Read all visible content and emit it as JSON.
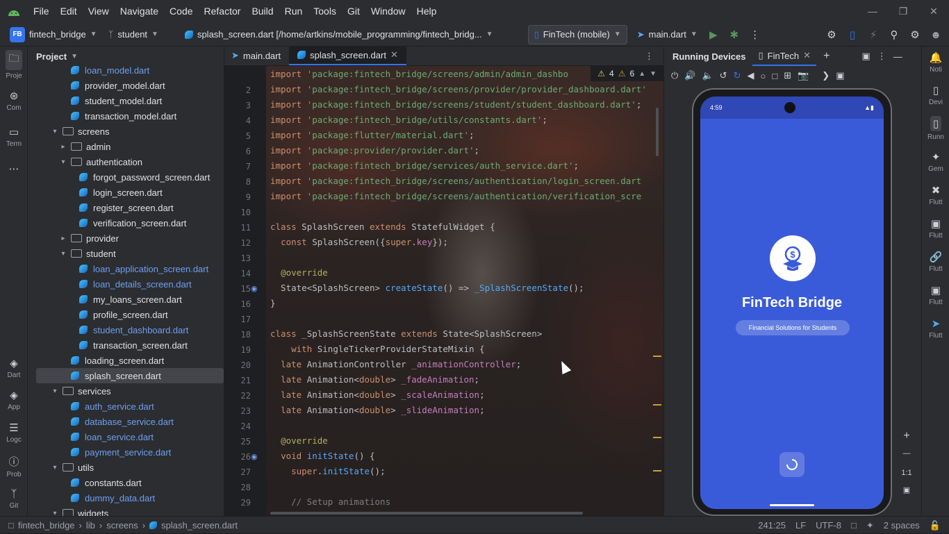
{
  "menu": [
    "File",
    "Edit",
    "View",
    "Navigate",
    "Code",
    "Refactor",
    "Build",
    "Run",
    "Tools",
    "Git",
    "Window",
    "Help"
  ],
  "toolbar": {
    "project_badge": "FB",
    "project_name": "fintech_bridge",
    "branch": "student",
    "file_path": "splash_screen.dart [/home/artkins/mobile_programming/fintech_bridg...",
    "device": "FinTech (mobile)",
    "run_config": "main.dart"
  },
  "left_strip": [
    {
      "icon": "folder-icon",
      "label": "Proje"
    },
    {
      "icon": "commit-icon",
      "label": "Com"
    },
    {
      "icon": "terminal-icon",
      "label": "Term"
    },
    {
      "icon": "more-icon",
      "label": "..."
    },
    {
      "icon": "dart-icon",
      "label": "Dart"
    },
    {
      "icon": "app-inspection-icon",
      "label": "App"
    },
    {
      "icon": "logcat-icon",
      "label": "Logc"
    },
    {
      "icon": "problems-icon",
      "label": "Prob"
    },
    {
      "icon": "git-icon",
      "label": "Git"
    }
  ],
  "project_panel": {
    "title": "Project",
    "tree": [
      {
        "label": "loan_model.dart",
        "type": "dart",
        "depth": 3,
        "blue": true
      },
      {
        "label": "provider_model.dart",
        "type": "dart",
        "depth": 3
      },
      {
        "label": "student_model.dart",
        "type": "dart",
        "depth": 3
      },
      {
        "label": "transaction_model.dart",
        "type": "dart",
        "depth": 3
      },
      {
        "label": "screens",
        "type": "folder",
        "depth": 2,
        "open": true
      },
      {
        "label": "admin",
        "type": "folder",
        "depth": 3,
        "open": false
      },
      {
        "label": "authentication",
        "type": "folder",
        "depth": 3,
        "open": true
      },
      {
        "label": "forgot_password_screen.dart",
        "type": "dart",
        "depth": 4
      },
      {
        "label": "login_screen.dart",
        "type": "dart",
        "depth": 4
      },
      {
        "label": "register_screen.dart",
        "type": "dart",
        "depth": 4
      },
      {
        "label": "verification_screen.dart",
        "type": "dart",
        "depth": 4
      },
      {
        "label": "provider",
        "type": "folder",
        "depth": 3,
        "open": false
      },
      {
        "label": "student",
        "type": "folder",
        "depth": 3,
        "open": true
      },
      {
        "label": "loan_application_screen.dart",
        "type": "dart",
        "depth": 4,
        "blue": true
      },
      {
        "label": "loan_details_screen.dart",
        "type": "dart",
        "depth": 4,
        "blue": true
      },
      {
        "label": "my_loans_screen.dart",
        "type": "dart",
        "depth": 4
      },
      {
        "label": "profile_screen.dart",
        "type": "dart",
        "depth": 4
      },
      {
        "label": "student_dashboard.dart",
        "type": "dart",
        "depth": 4,
        "blue": true
      },
      {
        "label": "transaction_screen.dart",
        "type": "dart",
        "depth": 4
      },
      {
        "label": "loading_screen.dart",
        "type": "dart",
        "depth": 3
      },
      {
        "label": "splash_screen.dart",
        "type": "dart",
        "depth": 3,
        "selected": true
      },
      {
        "label": "services",
        "type": "folder",
        "depth": 2,
        "open": true
      },
      {
        "label": "auth_service.dart",
        "type": "dart",
        "depth": 3,
        "blue": true
      },
      {
        "label": "database_service.dart",
        "type": "dart",
        "depth": 3,
        "blue": true
      },
      {
        "label": "loan_service.dart",
        "type": "dart",
        "depth": 3,
        "blue": true
      },
      {
        "label": "payment_service.dart",
        "type": "dart",
        "depth": 3,
        "blue": true
      },
      {
        "label": "utils",
        "type": "folder",
        "depth": 2,
        "open": true
      },
      {
        "label": "constants.dart",
        "type": "dart",
        "depth": 3
      },
      {
        "label": "dummy_data.dart",
        "type": "dart",
        "depth": 3,
        "blue": true
      },
      {
        "label": "widgets",
        "type": "folder",
        "depth": 2,
        "open": true
      }
    ]
  },
  "editor": {
    "tabs": [
      {
        "label": "main.dart",
        "active": false
      },
      {
        "label": "splash_screen.dart",
        "active": true
      }
    ],
    "warnings": "4",
    "weak_warnings": "6",
    "lines": [
      {
        "n": "",
        "html": "<span class='k'>import</span> <span class='s'>'package:fintech_bridge/screens/admin/admin_dashbo</span>"
      },
      {
        "n": "2",
        "html": "<span class='k'>import</span> <span class='s'>'package:fintech_bridge/screens/provider/provider_dashboard.dart'</span>"
      },
      {
        "n": "3",
        "html": "<span class='k'>import</span> <span class='s'>'package:fintech_bridge/screens/student/student_dashboard.dart'</span>;"
      },
      {
        "n": "4",
        "html": "<span class='k'>import</span> <span class='s'>'package:fintech_bridge/utils/constants.dart'</span>;"
      },
      {
        "n": "5",
        "html": "<span class='k'>import</span> <span class='s'>'package:flutter/material.dart'</span>;"
      },
      {
        "n": "6",
        "html": "<span class='k'>import</span> <span class='s'>'package:provider/provider.dart'</span>;"
      },
      {
        "n": "7",
        "html": "<span class='k'>import</span> <span class='s'>'package:fintech_bridge/services/auth_service.dart'</span>;"
      },
      {
        "n": "8",
        "html": "<span class='k'>import</span> <span class='s'>'package:fintech_bridge/screens/authentication/login_screen.dart</span>"
      },
      {
        "n": "9",
        "html": "<span class='k'>import</span> <span class='s'>'package:fintech_bridge/screens/authentication/verification_scre</span>"
      },
      {
        "n": "10",
        "html": ""
      },
      {
        "n": "11",
        "html": "<span class='k'>class</span> SplashScreen <span class='k'>extends</span> StatefulWidget {"
      },
      {
        "n": "12",
        "html": "  <span class='k'>const</span> SplashScreen({<span class='k'>super</span>.<span class='p'>key</span>});"
      },
      {
        "n": "13",
        "html": ""
      },
      {
        "n": "14",
        "html": "  <span class='an'>@override</span>"
      },
      {
        "n": "15",
        "html": "  State&lt;SplashScreen&gt; <span class='f'>createState</span>() =&gt; <span class='f'>_SplashScreenState</span>();"
      },
      {
        "n": "16",
        "html": "}"
      },
      {
        "n": "17",
        "html": ""
      },
      {
        "n": "18",
        "html": "<span class='k'>class</span> _SplashScreenState <span class='k'>extends</span> State&lt;SplashScreen&gt;"
      },
      {
        "n": "19",
        "html": "    <span class='k'>with</span> SingleTickerProviderStateMixin {"
      },
      {
        "n": "20",
        "html": "  <span class='k'>late</span> AnimationController <span class='p'>_animationController</span>;"
      },
      {
        "n": "21",
        "html": "  <span class='k'>late</span> Animation&lt;<span class='k'>double</span>&gt; <span class='p'>_fadeAnimation</span>;"
      },
      {
        "n": "22",
        "html": "  <span class='k'>late</span> Animation&lt;<span class='k'>double</span>&gt; <span class='p'>_scaleAnimation</span>;"
      },
      {
        "n": "23",
        "html": "  <span class='k'>late</span> Animation&lt;<span class='k'>double</span>&gt; <span class='p'>_slideAnimation</span>;"
      },
      {
        "n": "24",
        "html": ""
      },
      {
        "n": "25",
        "html": "  <span class='an'>@override</span>"
      },
      {
        "n": "26",
        "html": "  <span class='k'>void</span> <span class='f'>initState</span>() {"
      },
      {
        "n": "27",
        "html": "    <span class='k'>super</span>.<span class='f'>initState</span>();"
      },
      {
        "n": "28",
        "html": ""
      },
      {
        "n": "29",
        "html": "    <span class='cm'>// Setup animations</span>"
      }
    ]
  },
  "devices": {
    "title": "Running Devices",
    "tab": "FinTech",
    "phone": {
      "time": "4:59",
      "app_title": "FinTech Bridge",
      "app_subtitle": "Financial Solutions for Students"
    },
    "zoom_label": "1:1"
  },
  "right_strip": [
    {
      "icon": "notifications-icon",
      "label": "Noti"
    },
    {
      "icon": "device-manager-icon",
      "label": "Devi"
    },
    {
      "icon": "running-devices-icon",
      "label": "Runn"
    },
    {
      "icon": "gemini-icon",
      "label": "Gem"
    },
    {
      "icon": "flutter-inspector-icon",
      "label": "Flutt"
    },
    {
      "icon": "flutter-outline-icon",
      "label": "Flutt"
    },
    {
      "icon": "flutter-deeplinks-icon",
      "label": "Flutt"
    },
    {
      "icon": "flutter-performance-icon",
      "label": "Flutt"
    },
    {
      "icon": "flutter-icon",
      "label": "Flutt"
    }
  ],
  "status": {
    "crumbs": [
      "fintech_bridge",
      "lib",
      "screens",
      "splash_screen.dart"
    ],
    "position": "241:25",
    "line_sep": "LF",
    "encoding": "UTF-8",
    "indent": "2 spaces"
  }
}
